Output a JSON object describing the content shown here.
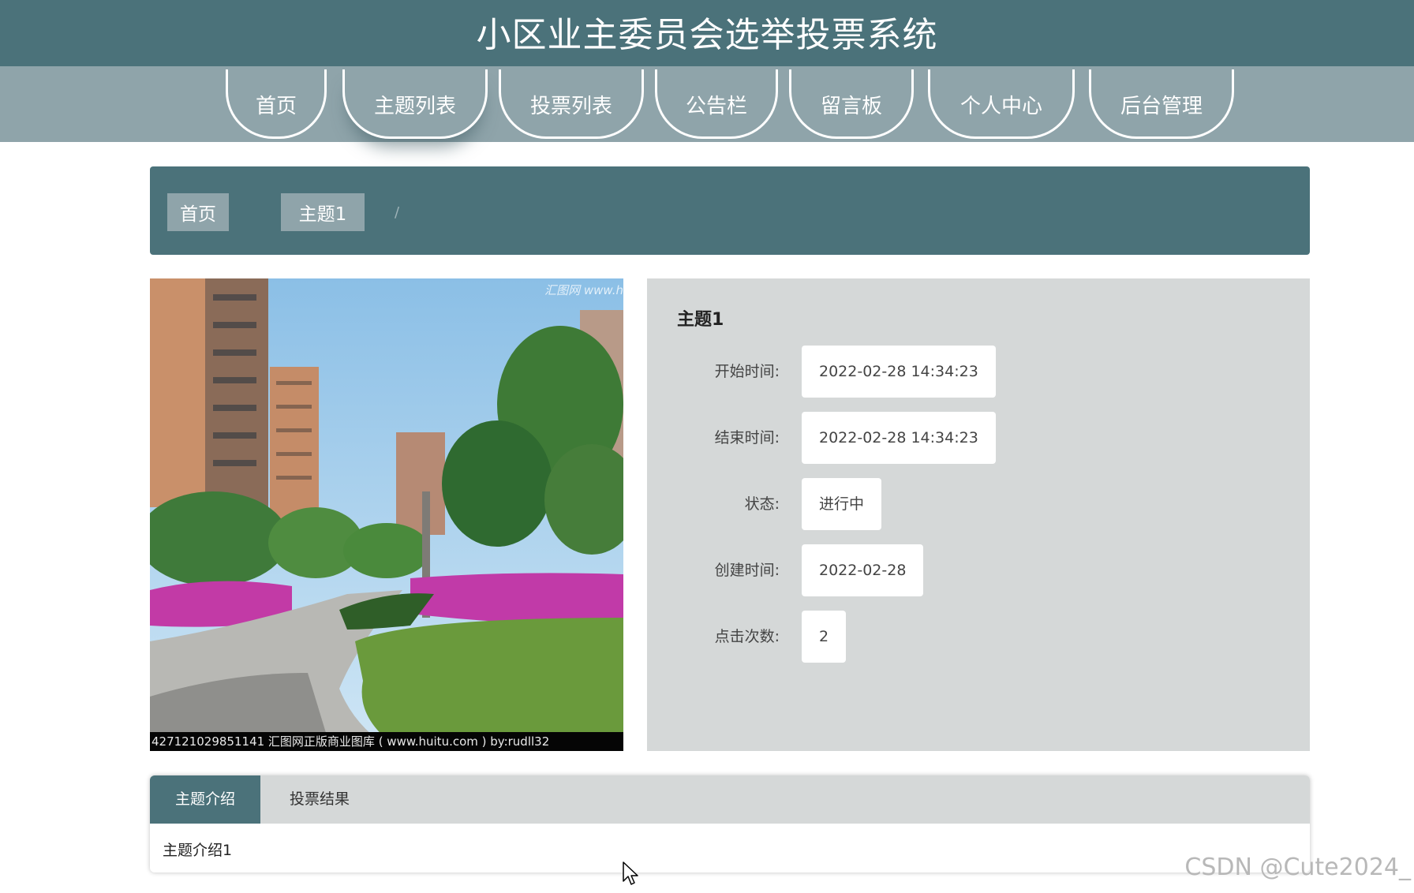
{
  "header": {
    "title": "小区业主委员会选举投票系统"
  },
  "nav": {
    "items": [
      {
        "label": "首页"
      },
      {
        "label": "主题列表"
      },
      {
        "label": "投票列表"
      },
      {
        "label": "公告栏"
      },
      {
        "label": "留言板"
      },
      {
        "label": "个人中心"
      },
      {
        "label": "后台管理"
      }
    ],
    "active_index": 1
  },
  "breadcrumb": {
    "home": "首页",
    "separator": "/",
    "current": "主题1"
  },
  "photo": {
    "watermark": "汇图网 www.h",
    "caption": "427121029851141 汇图网正版商业图库 ( www.huitu.com ) by:rudll32"
  },
  "detail": {
    "title": "主题1",
    "fields": [
      {
        "label": "开始时间:",
        "value": "2022-02-28 14:34:23"
      },
      {
        "label": "结束时间:",
        "value": "2022-02-28 14:34:23"
      },
      {
        "label": "状态:",
        "value": "进行中"
      },
      {
        "label": "创建时间:",
        "value": "2022-02-28"
      },
      {
        "label": "点击次数:",
        "value": "2"
      }
    ]
  },
  "tabs": {
    "items": [
      {
        "label": "主题介绍"
      },
      {
        "label": "投票结果"
      }
    ],
    "active_index": 0,
    "content": "主题介绍1"
  },
  "watermark": "CSDN @Cute2024_",
  "colors": {
    "primary": "#4b727a",
    "secondary": "#8fa4aa",
    "panel": "#d5d8d8"
  }
}
